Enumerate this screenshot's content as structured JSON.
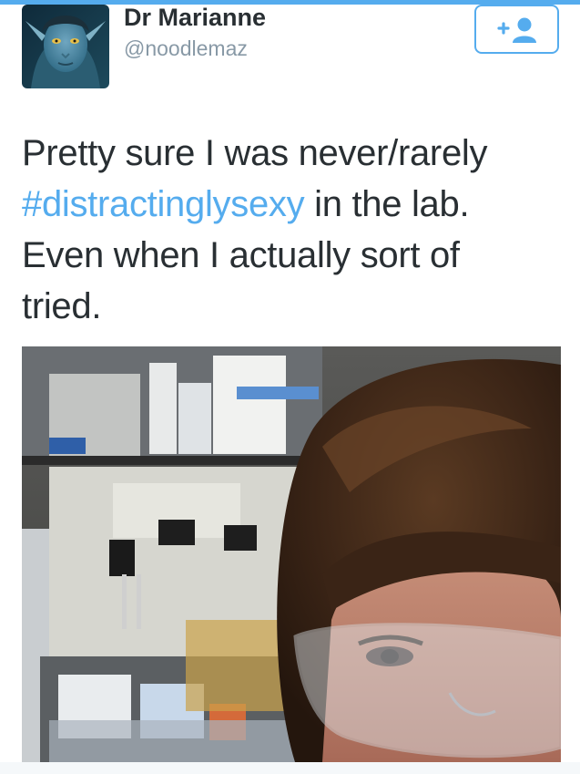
{
  "profile": {
    "name": "Dr Marianne",
    "handle": "@noodlemaz",
    "avatar_icon": "profile-avatar-image"
  },
  "follow_button": {
    "icon": "add-user-icon",
    "color": "#55acee"
  },
  "tweet": {
    "line1": "Pretty sure I was never/rarely",
    "hashtag": "#distractinglysexy",
    "line2_rest": " in the lab.",
    "line3": "Even when I actually sort of",
    "line4": "tried."
  },
  "colors": {
    "accent": "#55acee",
    "text": "#292f33",
    "muted": "#8899a6"
  }
}
